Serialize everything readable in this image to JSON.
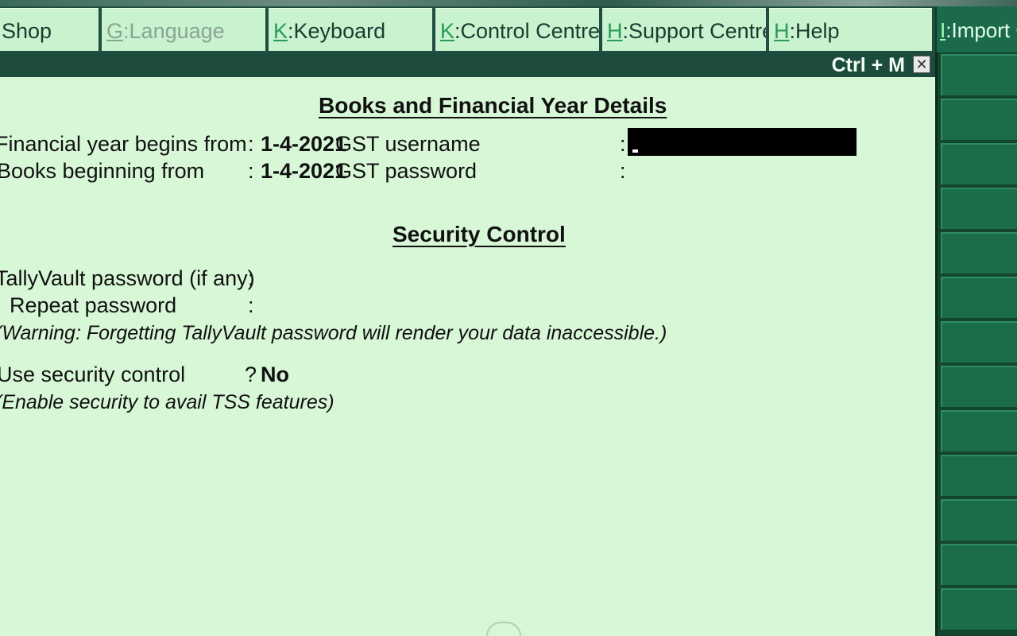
{
  "menu": {
    "items": [
      {
        "key": "",
        "label": "Shop",
        "enabled": true
      },
      {
        "key": "G",
        "label": "Language",
        "enabled": false
      },
      {
        "key": "K",
        "label": "Keyboard",
        "enabled": true
      },
      {
        "key": "K",
        "label": "Control Centre",
        "enabled": true
      },
      {
        "key": "H",
        "label": "Support Centre",
        "enabled": true
      },
      {
        "key": "H",
        "label": "Help",
        "enabled": true
      }
    ],
    "right_button": {
      "key": "I",
      "label": "Import GS"
    }
  },
  "titlebar": {
    "shortcut": "Ctrl + M",
    "close_icon": "close-icon"
  },
  "books": {
    "heading": "Books and Financial Year Details",
    "fy_label": "Financial year begins from",
    "fy_value": "1-4-2021",
    "books_label": "Books beginning from",
    "books_value": "1-4-2021",
    "gst_username_label": "GST username",
    "gst_username_value": "",
    "gst_password_label": "GST password"
  },
  "security": {
    "heading": "Security Control",
    "vault_label": "TallyVault password (if any)",
    "repeat_label": "Repeat password",
    "warning": "(Warning: Forgetting TallyVault password will render your data inaccessible.)",
    "use_control_label": "Use security control",
    "use_control_value": "No",
    "tss_note": "(Enable security to avail TSS features)"
  },
  "colors": {
    "background": "#d7f7d7",
    "menu_bar": "#1f4d40",
    "menu_button": "#c9f2cf",
    "side_panel": "#14452f",
    "side_button": "#1b6d49"
  }
}
